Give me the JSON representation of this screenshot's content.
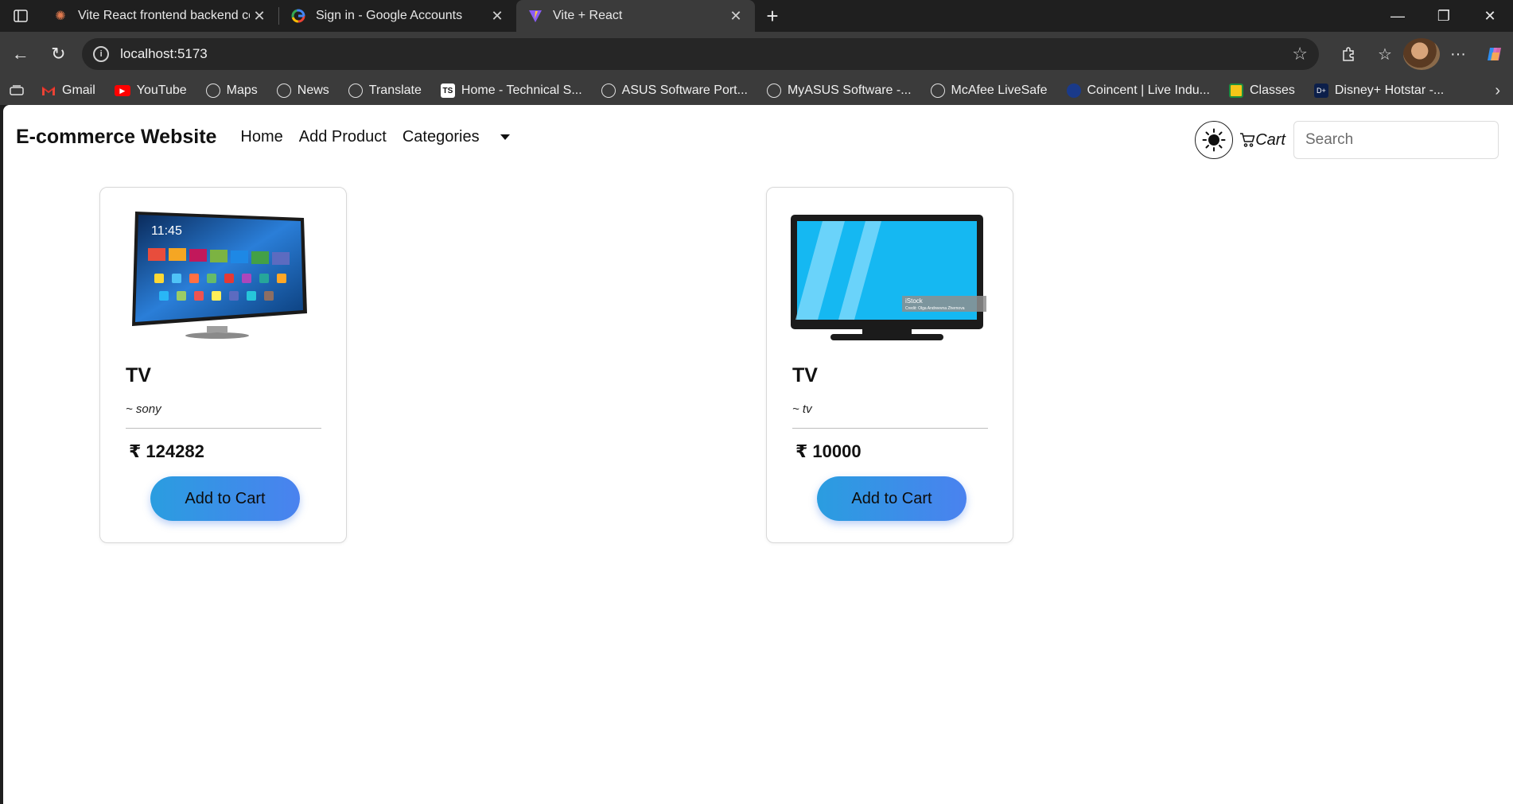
{
  "browser": {
    "tabs": [
      {
        "title": "Vite React frontend backend conn"
      },
      {
        "title": "Sign in - Google Accounts"
      },
      {
        "title": "Vite + React"
      }
    ],
    "url": "localhost:5173",
    "bookmarks": [
      {
        "label": "Gmail",
        "icon": "gmail-icon"
      },
      {
        "label": "YouTube",
        "icon": "youtube-icon"
      },
      {
        "label": "Maps",
        "icon": "globe-icon"
      },
      {
        "label": "News",
        "icon": "globe-icon"
      },
      {
        "label": "Translate",
        "icon": "globe-icon"
      },
      {
        "label": "Home - Technical S...",
        "icon": "ts-icon"
      },
      {
        "label": "ASUS Software Port...",
        "icon": "globe-icon"
      },
      {
        "label": "MyASUS Software -...",
        "icon": "globe-icon"
      },
      {
        "label": "McAfee LiveSafe",
        "icon": "globe-icon"
      },
      {
        "label": "Coincent | Live Indu...",
        "icon": "coincent-icon"
      },
      {
        "label": "Classes",
        "icon": "classroom-icon"
      },
      {
        "label": "Disney+ Hotstar -...",
        "icon": "hotstar-icon"
      }
    ]
  },
  "navbar": {
    "brand": "E-commerce Website",
    "links": {
      "home": "Home",
      "add_product": "Add Product",
      "categories": "Categories"
    },
    "cart": "Cart",
    "search_placeholder": "Search"
  },
  "products": [
    {
      "name": "TV",
      "brand": "~ sony",
      "price": "₹ 124282",
      "button": "Add to Cart"
    },
    {
      "name": "TV",
      "brand": "~ tv",
      "price": "₹ 10000",
      "button": "Add to Cart"
    }
  ],
  "images": {
    "tv1_clock": "11:45",
    "tv2_watermark_brand": "iStock",
    "tv2_watermark_credit": "Credit: Olga Andreevna Zhernova"
  },
  "colors": {
    "button_gradient_start": "#2a9de0",
    "button_gradient_end": "#4a82ef",
    "tv_screen_blue": "#15b8f2"
  }
}
